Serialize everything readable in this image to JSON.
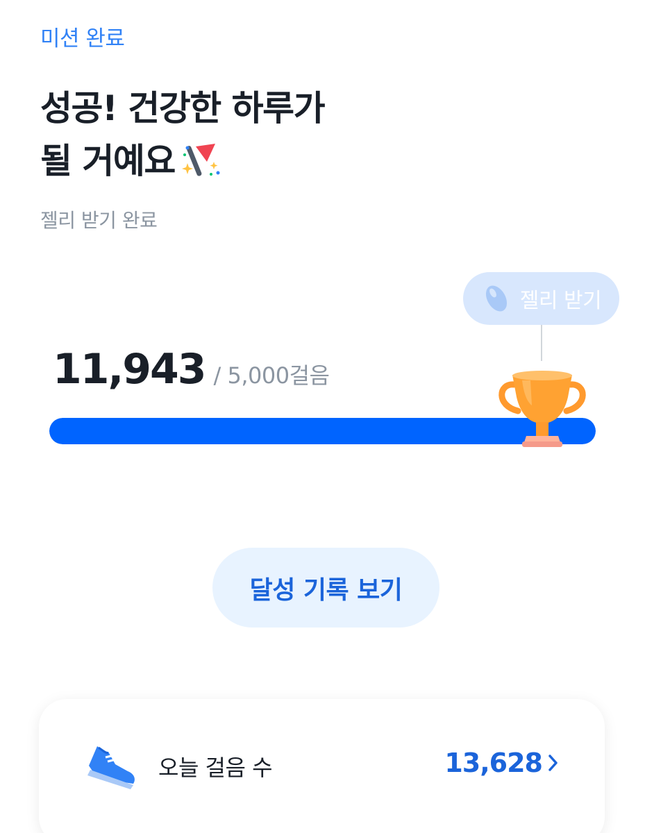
{
  "header": {
    "mission_status": "미션 완료",
    "headline_line1": "성공! 건강한 하루가",
    "headline_line2": "될 거예요",
    "headline_icon": "party-popper-icon",
    "reward_status": "젤리 받기 완료"
  },
  "progress": {
    "reward_bubble_label": "젤리 받기",
    "reward_icon": "jelly-bean-icon",
    "steps_count": "11,943",
    "steps_goal": "/ 5,000걸음",
    "fill_fraction": 1.0,
    "goal_icon": "trophy-icon"
  },
  "actions": {
    "history_button_label": "달성 기록 보기"
  },
  "today_card": {
    "icon": "sneaker-icon",
    "label": "오늘 걸음 수",
    "value": "13,628",
    "chevron_icon": "chevron-right-icon"
  },
  "colors": {
    "accent_blue": "#3182f6",
    "progress_fill": "#0064ff",
    "button_bg": "#e8f3ff",
    "button_text": "#1b64da",
    "bubble_bg": "#d8e7fd",
    "trophy": "#ff9a2e"
  }
}
